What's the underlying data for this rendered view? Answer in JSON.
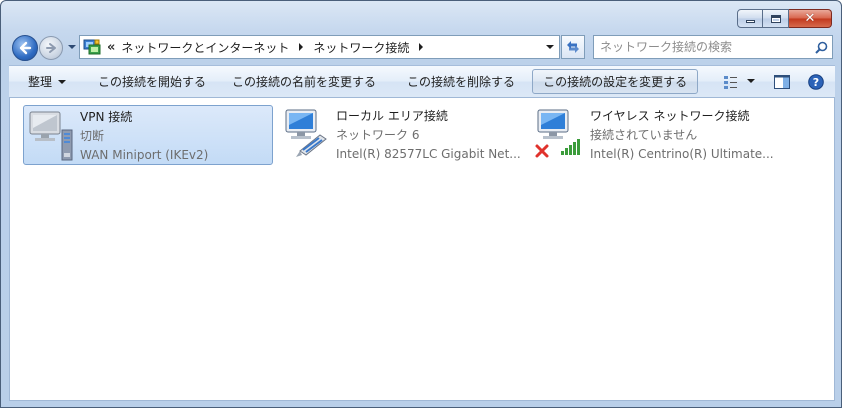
{
  "address": {
    "overflow": "«",
    "crumbs": [
      "ネットワークとインターネット",
      "ネットワーク接続"
    ]
  },
  "search": {
    "placeholder": "ネットワーク接続の検索"
  },
  "commandbar": {
    "organize": "整理",
    "start_connection": "この接続を開始する",
    "rename_connection": "この接続の名前を変更する",
    "delete_connection": "この接続を削除する",
    "change_settings": "この接続の設定を変更する"
  },
  "connections": [
    {
      "name": "VPN 接続",
      "status": "切断",
      "device": "WAN Miniport (IKEv2)",
      "icon": "vpn-connection-icon"
    },
    {
      "name": "ローカル エリア接続",
      "status": "ネットワーク  6",
      "device": "Intel(R) 82577LC Gigabit Net...",
      "icon": "lan-connection-icon"
    },
    {
      "name": "ワイヤレス ネットワーク接続",
      "status": "接続されていません",
      "device": "Intel(R) Centrino(R) Ultimate...",
      "icon": "wireless-connection-icon"
    }
  ],
  "colors": {
    "selection": "#c3dbf6",
    "selection_border": "#7da2ce",
    "close_button": "#c2391e"
  }
}
